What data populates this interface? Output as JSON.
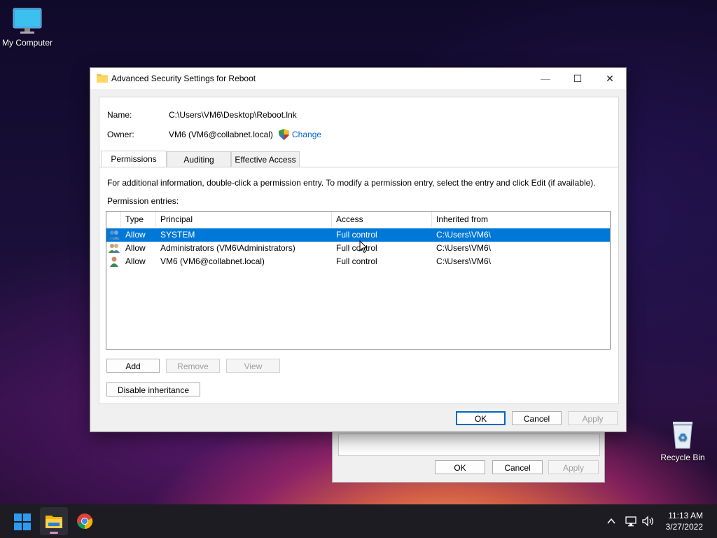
{
  "desktop": {
    "icons": [
      {
        "label": "My Computer",
        "icon": "monitor-icon"
      },
      {
        "label": "Recycle Bin",
        "icon": "recycle-bin-icon"
      }
    ]
  },
  "background_dialog": {
    "ok_label": "OK",
    "cancel_label": "Cancel",
    "apply_label": "Apply"
  },
  "window": {
    "title": "Advanced Security Settings for Reboot",
    "controls": {
      "minimize": "—",
      "maximize": "☐",
      "close": "✕"
    },
    "name_label": "Name:",
    "name_value": "C:\\Users\\VM6\\Desktop\\Reboot.lnk",
    "owner_label": "Owner:",
    "owner_value": "VM6 (VM6@collabnet.local)",
    "change_label": "Change",
    "tabs": [
      {
        "label": "Permissions",
        "active": true
      },
      {
        "label": "Auditing",
        "active": false
      },
      {
        "label": "Effective Access",
        "active": false
      }
    ],
    "info_text": "For additional information, double-click a permission entry. To modify a permission entry, select the entry and click Edit (if available).",
    "entries_label": "Permission entries:",
    "table": {
      "headers": [
        "Type",
        "Principal",
        "Access",
        "Inherited from"
      ],
      "rows": [
        {
          "type": "Allow",
          "principal": "SYSTEM",
          "access": "Full control",
          "inherited": "C:\\Users\\VM6\\",
          "icon": "group-users-icon",
          "selected": true
        },
        {
          "type": "Allow",
          "principal": "Administrators (VM6\\Administrators)",
          "access": "Full control",
          "inherited": "C:\\Users\\VM6\\",
          "icon": "group-users-icon",
          "selected": false
        },
        {
          "type": "Allow",
          "principal": "VM6 (VM6@collabnet.local)",
          "access": "Full control",
          "inherited": "C:\\Users\\VM6\\",
          "icon": "user-icon",
          "selected": false
        }
      ]
    },
    "buttons": {
      "add": "Add",
      "remove": "Remove",
      "view": "View",
      "disable_inheritance": "Disable inheritance",
      "ok": "OK",
      "cancel": "Cancel",
      "apply": "Apply"
    }
  },
  "taskbar": {
    "time": "11:13 AM",
    "date": "3/27/2022",
    "apps": [
      "windows-start-icon",
      "file-explorer-icon",
      "chrome-icon"
    ],
    "tray": [
      "chevron-up-icon",
      "network-icon",
      "volume-icon"
    ]
  },
  "colors": {
    "selection": "#0078d7",
    "accent": "#0067c0",
    "link": "#0066cc"
  }
}
